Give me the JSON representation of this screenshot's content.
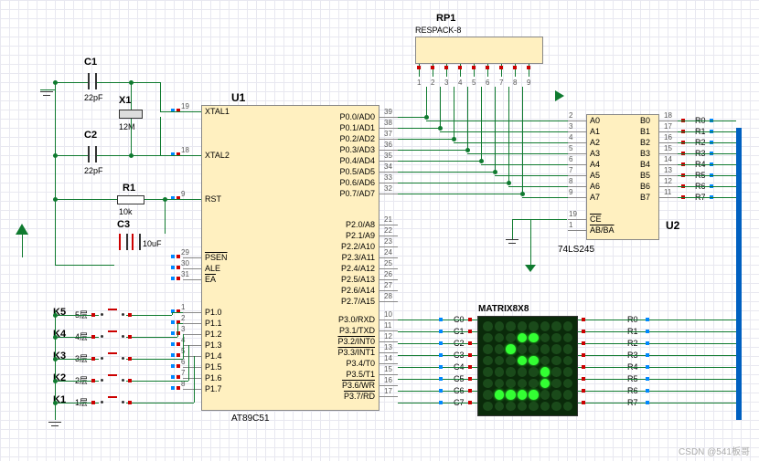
{
  "components": {
    "U1": {
      "ref": "U1",
      "part": "AT89C51",
      "left_pins": [
        {
          "num": "19",
          "name": "XTAL1"
        },
        {
          "num": "18",
          "name": "XTAL2"
        },
        {
          "num": "9",
          "name": "RST"
        },
        {
          "num": "29",
          "name": "PSEN",
          "over": true
        },
        {
          "num": "30",
          "name": "ALE"
        },
        {
          "num": "31",
          "name": "EA",
          "over": true
        },
        {
          "num": "1",
          "name": "P1.0"
        },
        {
          "num": "2",
          "name": "P1.1"
        },
        {
          "num": "3",
          "name": "P1.2"
        },
        {
          "num": "4",
          "name": "P1.3"
        },
        {
          "num": "5",
          "name": "P1.4"
        },
        {
          "num": "6",
          "name": "P1.5"
        },
        {
          "num": "7",
          "name": "P1.6"
        },
        {
          "num": "8",
          "name": "P1.7"
        }
      ],
      "right_pins": [
        {
          "num": "39",
          "name": "P0.0/AD0"
        },
        {
          "num": "38",
          "name": "P0.1/AD1"
        },
        {
          "num": "37",
          "name": "P0.2/AD2"
        },
        {
          "num": "36",
          "name": "P0.3/AD3"
        },
        {
          "num": "35",
          "name": "P0.4/AD4"
        },
        {
          "num": "34",
          "name": "P0.5/AD5"
        },
        {
          "num": "33",
          "name": "P0.6/AD6"
        },
        {
          "num": "32",
          "name": "P0.7/AD7"
        },
        {
          "num": "21",
          "name": "P2.0/A8"
        },
        {
          "num": "22",
          "name": "P2.1/A9"
        },
        {
          "num": "23",
          "name": "P2.2/A10"
        },
        {
          "num": "24",
          "name": "P2.3/A11"
        },
        {
          "num": "25",
          "name": "P2.4/A12"
        },
        {
          "num": "26",
          "name": "P2.5/A13"
        },
        {
          "num": "27",
          "name": "P2.6/A14"
        },
        {
          "num": "28",
          "name": "P2.7/A15"
        },
        {
          "num": "10",
          "name": "P3.0/RXD"
        },
        {
          "num": "11",
          "name": "P3.1/TXD"
        },
        {
          "num": "12",
          "name": "P3.2/INT0",
          "over": true
        },
        {
          "num": "13",
          "name": "P3.3/INT1",
          "over": true
        },
        {
          "num": "14",
          "name": "P3.4/T0"
        },
        {
          "num": "15",
          "name": "P3.5/T1"
        },
        {
          "num": "16",
          "name": "P3.6/WR",
          "over": true
        },
        {
          "num": "17",
          "name": "P3.7/RD",
          "over": true
        }
      ]
    },
    "U2": {
      "ref": "U2",
      "part": "74LS245",
      "left_pins": [
        {
          "num": "2",
          "name": "A0"
        },
        {
          "num": "3",
          "name": "A1"
        },
        {
          "num": "4",
          "name": "A2"
        },
        {
          "num": "5",
          "name": "A3"
        },
        {
          "num": "6",
          "name": "A4"
        },
        {
          "num": "7",
          "name": "A5"
        },
        {
          "num": "8",
          "name": "A6"
        },
        {
          "num": "9",
          "name": "A7"
        },
        {
          "num": "19",
          "name": "CE",
          "over": true
        },
        {
          "num": "1",
          "name": "AB/BA",
          "over": true
        }
      ],
      "right_pins": [
        {
          "num": "18",
          "name": "B0"
        },
        {
          "num": "17",
          "name": "B1"
        },
        {
          "num": "16",
          "name": "B2"
        },
        {
          "num": "15",
          "name": "B3"
        },
        {
          "num": "14",
          "name": "B4"
        },
        {
          "num": "13",
          "name": "B5"
        },
        {
          "num": "12",
          "name": "B6"
        },
        {
          "num": "11",
          "name": "B7"
        }
      ]
    },
    "RP1": {
      "ref": "RP1",
      "part": "RESPACK-8",
      "pins": [
        "1",
        "2",
        "3",
        "4",
        "5",
        "6",
        "7",
        "8",
        "9"
      ]
    },
    "C1": {
      "ref": "C1",
      "val": "22pF"
    },
    "C2": {
      "ref": "C2",
      "val": "22pF"
    },
    "C3": {
      "ref": "C3",
      "val": "10uF"
    },
    "X1": {
      "ref": "X1",
      "val": "12M"
    },
    "R1": {
      "ref": "R1",
      "val": "10k"
    },
    "matrix": {
      "ref": "MATRIX8X8"
    }
  },
  "buttons": [
    {
      "ref": "K5",
      "label": "5层"
    },
    {
      "ref": "K4",
      "label": "4层"
    },
    {
      "ref": "K3",
      "label": "3层"
    },
    {
      "ref": "K2",
      "label": "2层"
    },
    {
      "ref": "K1",
      "label": "1层"
    }
  ],
  "matrix_rows_left": [
    "C0",
    "C1",
    "C2",
    "C3",
    "C4",
    "C5",
    "C6",
    "C7"
  ],
  "matrix_rows_right": [
    "R0",
    "R1",
    "R2",
    "R3",
    "R4",
    "R5",
    "R6",
    "R7"
  ],
  "u2_net_right": [
    "R0",
    "R1",
    "R2",
    "R3",
    "R4",
    "R5",
    "R6",
    "R7"
  ],
  "watermark": "CSDN @541板哥",
  "chart_data": {
    "type": "table",
    "title": "8x8 LED matrix pattern (1=on)",
    "rows": [
      [
        0,
        0,
        0,
        0,
        0,
        0,
        0,
        0
      ],
      [
        0,
        0,
        0,
        1,
        1,
        0,
        0,
        0
      ],
      [
        0,
        0,
        1,
        0,
        0,
        0,
        0,
        0
      ],
      [
        0,
        0,
        0,
        1,
        1,
        0,
        0,
        0
      ],
      [
        0,
        0,
        0,
        0,
        0,
        1,
        0,
        0
      ],
      [
        0,
        0,
        0,
        0,
        0,
        1,
        0,
        0
      ],
      [
        0,
        1,
        1,
        1,
        1,
        0,
        0,
        0
      ],
      [
        0,
        0,
        0,
        0,
        0,
        0,
        0,
        0
      ]
    ]
  }
}
